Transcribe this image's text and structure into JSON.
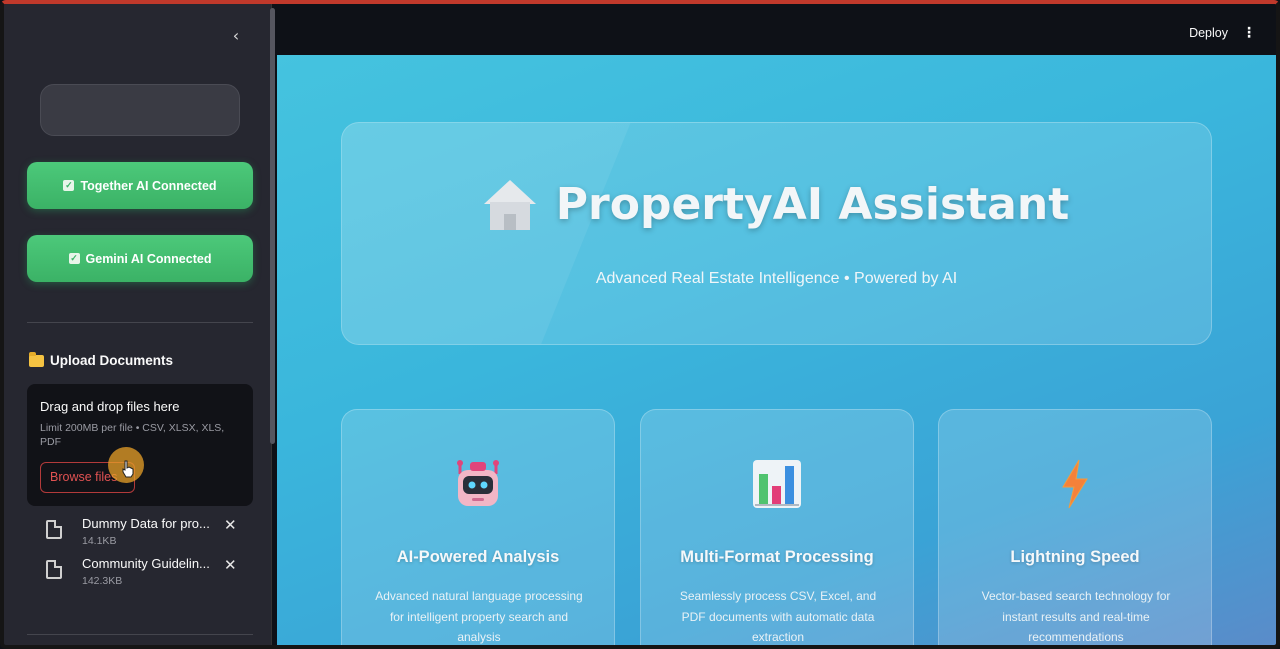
{
  "sidebar": {
    "connections": [
      {
        "label": "Together AI Connected"
      },
      {
        "label": "Gemini AI Connected"
      }
    ],
    "upload": {
      "title": "Upload Documents",
      "drop_text": "Drag and drop files here",
      "limit_text": "Limit 200MB per file • CSV, XLSX, XLS, PDF",
      "browse_label": "Browse files"
    },
    "files": [
      {
        "name": "Dummy Data for pro...",
        "size": "14.1KB"
      },
      {
        "name": "Community Guidelin...",
        "size": "142.3KB"
      }
    ]
  },
  "topbar": {
    "deploy_label": "Deploy"
  },
  "hero": {
    "title": "PropertyAI Assistant",
    "icon": "house-icon",
    "subtitle": "Advanced Real Estate Intelligence • Powered by AI"
  },
  "features": [
    {
      "icon": "robot-icon",
      "title": "AI-Powered Analysis",
      "description": "Advanced natural language processing for intelligent property search and analysis"
    },
    {
      "icon": "bar-chart-icon",
      "title": "Multi-Format Processing",
      "description": "Seamlessly process CSV, Excel, and PDF documents with automatic data extraction"
    },
    {
      "icon": "lightning-icon",
      "title": "Lightning Speed",
      "description": "Vector-based search technology for instant results and real-time recommendations"
    }
  ],
  "colors": {
    "connected_green": "#3bb266",
    "main_gradient_start": "#45c3df",
    "main_gradient_end": "#5b8bc9",
    "browse_red": "#e05252"
  }
}
